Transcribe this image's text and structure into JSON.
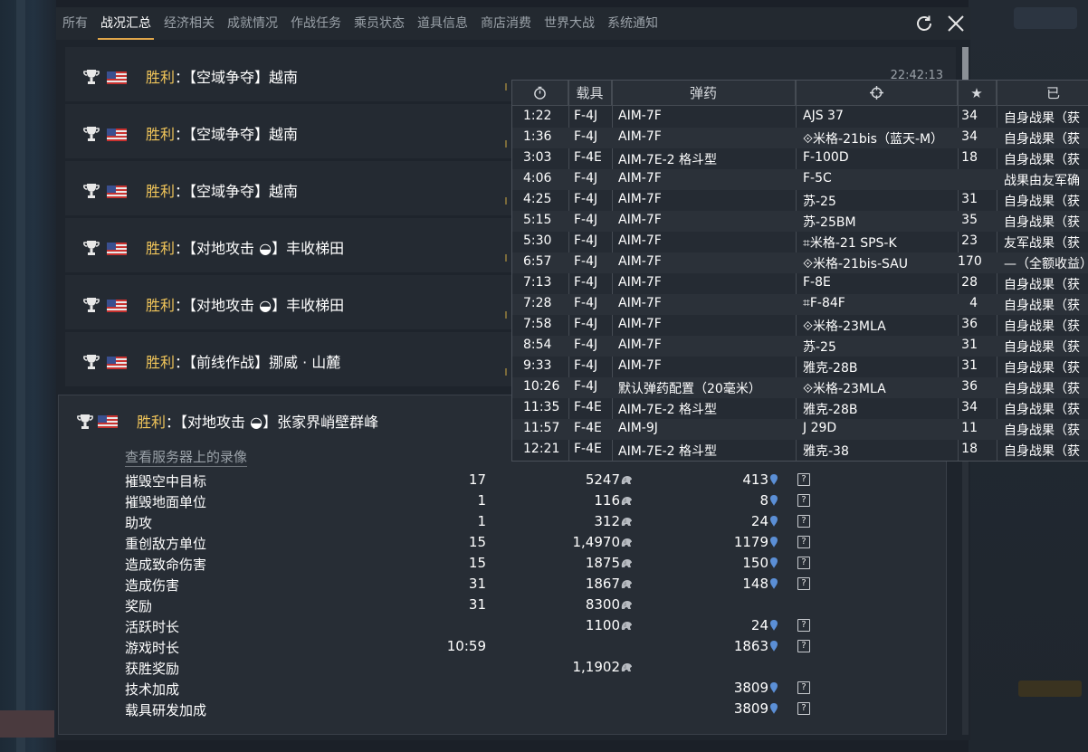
{
  "tabs": [
    {
      "label": "所有",
      "active": false
    },
    {
      "label": "战况汇总",
      "active": true
    },
    {
      "label": "经济相关",
      "active": false
    },
    {
      "label": "成就情况",
      "active": false
    },
    {
      "label": "作战任务",
      "active": false
    },
    {
      "label": "乘员状态",
      "active": false
    },
    {
      "label": "道具信息",
      "active": false
    },
    {
      "label": "商店消费",
      "active": false
    },
    {
      "label": "世界大战",
      "active": false
    },
    {
      "label": "系统通知",
      "active": false
    }
  ],
  "battles": [
    {
      "result": "胜利",
      "name": "：【空域争夺】越南",
      "time": "22:42:13"
    },
    {
      "result": "胜利",
      "name": "：【空域争夺】越南",
      "time": ""
    },
    {
      "result": "胜利",
      "name": "：【空域争夺】越南",
      "time": ""
    },
    {
      "result": "胜利",
      "name": "：【对地攻击 ◒】丰收梯田",
      "time": ""
    },
    {
      "result": "胜利",
      "name": "：【对地攻击 ◒】丰收梯田",
      "time": ""
    },
    {
      "result": "胜利",
      "name": "：【前线作战】挪威 · 山麓",
      "time": ""
    }
  ],
  "expanded": {
    "result": "胜利",
    "name": "：【对地攻击 ◒】张家界峭壁群峰",
    "replay_link": "查看服务器上的录像",
    "stats": [
      {
        "label": "摧毁空中目标",
        "count": "17",
        "silver": "5247",
        "rp": "413"
      },
      {
        "label": "摧毁地面单位",
        "count": "1",
        "silver": "116",
        "rp": "8"
      },
      {
        "label": "助攻",
        "count": "1",
        "silver": "312",
        "rp": "24"
      },
      {
        "label": "重创敌方单位",
        "count": "15",
        "silver": "1,4970",
        "rp": "1179"
      },
      {
        "label": "造成致命伤害",
        "count": "15",
        "silver": "1875",
        "rp": "150"
      },
      {
        "label": "造成伤害",
        "count": "31",
        "silver": "1867",
        "rp": "148"
      },
      {
        "label": "奖励",
        "count": "31",
        "silver": "8300",
        "rp": ""
      },
      {
        "label": "活跃时长",
        "count": "",
        "silver": "1100",
        "rp": "24"
      },
      {
        "label": "游戏时长",
        "count": "10:59",
        "silver": "",
        "rp": "1863"
      },
      {
        "label": "获胜奖励",
        "count": "",
        "silver": "1,1902",
        "rp": ""
      },
      {
        "label": "技术加成",
        "count": "",
        "silver": "",
        "rp": "3809"
      },
      {
        "label": "载具研发加成",
        "count": "",
        "silver": "",
        "rp": "3809"
      }
    ],
    "help_label": "?"
  },
  "tooltip": {
    "headers": {
      "veh": "载具",
      "ammo": "弹药",
      "star": "★",
      "res": "已"
    },
    "rows": [
      {
        "time": "1:22",
        "veh": "F-4J",
        "ammo": "AIM-7F",
        "tgt": "AJS 37",
        "star": "34",
        "res": "自身战果（获"
      },
      {
        "time": "1:36",
        "veh": "F-4J",
        "ammo": "AIM-7F",
        "tgt": "⟐米格-21bis（蓝天-M）",
        "star": "34",
        "res": "自身战果（获"
      },
      {
        "time": "3:03",
        "veh": "F-4E",
        "ammo": "AIM-7E-2 格斗型",
        "tgt": "F-100D",
        "star": "18",
        "res": "自身战果（获"
      },
      {
        "time": "4:06",
        "veh": "F-4J",
        "ammo": "AIM-7F",
        "tgt": "F-5C",
        "star": "",
        "res": "战果由友军确"
      },
      {
        "time": "4:25",
        "veh": "F-4J",
        "ammo": "AIM-7F",
        "tgt": "苏-25",
        "star": "31",
        "res": "自身战果（获"
      },
      {
        "time": "5:15",
        "veh": "F-4J",
        "ammo": "AIM-7F",
        "tgt": "苏-25BM",
        "star": "35",
        "res": "自身战果（获"
      },
      {
        "time": "5:30",
        "veh": "F-4J",
        "ammo": "AIM-7F",
        "tgt": "⌗米格-21 SPS-K",
        "star": "23",
        "res": "友军战果（获"
      },
      {
        "time": "6:57",
        "veh": "F-4J",
        "ammo": "AIM-7F",
        "tgt": "⟐米格-21bis-SAU",
        "star": "170",
        "res": "—（全额收益）"
      },
      {
        "time": "7:13",
        "veh": "F-4J",
        "ammo": "AIM-7F",
        "tgt": "F-8E",
        "star": "28",
        "res": "自身战果（获"
      },
      {
        "time": "7:28",
        "veh": "F-4J",
        "ammo": "AIM-7F",
        "tgt": "⌗F-84F",
        "star": "4",
        "res": "自身战果（获"
      },
      {
        "time": "7:58",
        "veh": "F-4J",
        "ammo": "AIM-7F",
        "tgt": "⟐米格-23MLA",
        "star": "36",
        "res": "自身战果（获"
      },
      {
        "time": "8:54",
        "veh": "F-4J",
        "ammo": "AIM-7F",
        "tgt": "苏-25",
        "star": "31",
        "res": "自身战果（获"
      },
      {
        "time": "9:33",
        "veh": "F-4J",
        "ammo": "AIM-7F",
        "tgt": "雅克-28B",
        "star": "31",
        "res": "自身战果（获"
      },
      {
        "time": "10:26",
        "veh": "F-4J",
        "ammo": "默认弹药配置（20毫米）",
        "tgt": "⟐米格-23MLA",
        "star": "36",
        "res": "自身战果（获"
      },
      {
        "time": "11:35",
        "veh": "F-4E",
        "ammo": "AIM-7E-2 格斗型",
        "tgt": "雅克-28B",
        "star": "34",
        "res": "自身战果（获"
      },
      {
        "time": "11:57",
        "veh": "F-4E",
        "ammo": "AIM-9J",
        "tgt": "J 29D",
        "star": "11",
        "res": "自身战果（获"
      },
      {
        "time": "12:21",
        "veh": "F-4E",
        "ammo": "AIM-7E-2 格斗型",
        "tgt": "雅克-38",
        "star": "18",
        "res": "自身战果（获"
      }
    ]
  },
  "colors": {
    "win": "#f2c65a",
    "tab_underline": "#e0a64a",
    "rp_icon": "#5b8fd6"
  },
  "icons": [
    "reload-icon",
    "close-icon",
    "trophy-icon",
    "us-flag-icon",
    "silver-lion-icon",
    "research-point-icon",
    "clock-icon",
    "crosshair-icon",
    "help-icon"
  ]
}
